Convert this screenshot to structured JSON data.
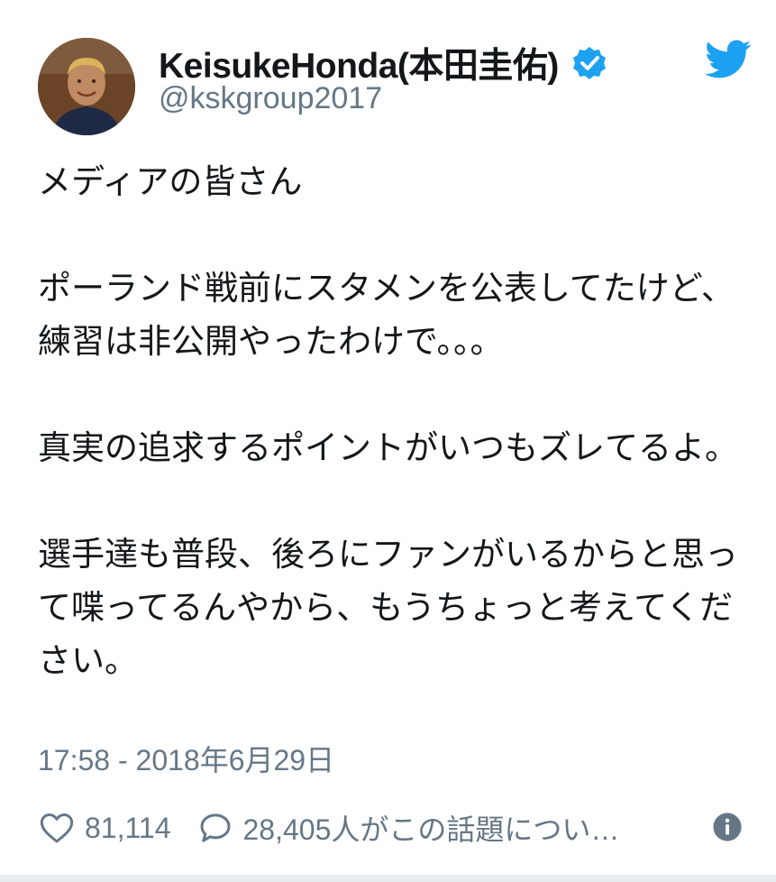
{
  "user": {
    "display_name": "KeisukeHonda(本田圭佑)",
    "handle": "@kskgroup2017",
    "verified": true,
    "avatar_icon": "profile-photo"
  },
  "brand": {
    "logo_icon": "twitter-bird-icon",
    "color": "#1da1f2"
  },
  "tweet": {
    "paragraphs": [
      "メディアの皆さん",
      "ポーランド戦前にスタメンを公表してたけど、練習は非公開やったわけで。。。",
      "真実の追求するポイントがいつもズレてるよ。",
      "選手達も普段、後ろにファンがいるからと思って喋ってるんやから、もうちょっと考えてください。"
    ]
  },
  "timestamp": "17:58 - 2018年6月29日",
  "stats": {
    "likes": "81,114",
    "replies_text": "28,405人がこの話題につい…"
  },
  "colors": {
    "text": "#14171a",
    "secondary": "#657786",
    "verified_badge": "#1da1f2"
  }
}
